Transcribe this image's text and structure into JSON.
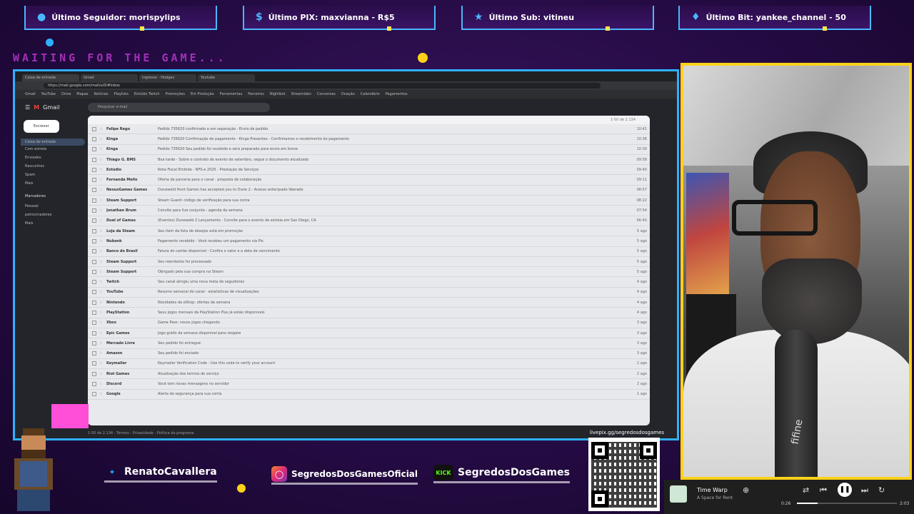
{
  "alerts": {
    "follower": "Último Seguidor: morispylips",
    "pix": "Último PIX: maxvianna - R$5",
    "sub": "Último Sub: vitineu",
    "bit": "Último Bit: yankee_channel - 50"
  },
  "overlay": {
    "waiting_text": "WAITING FOR THE GAME..."
  },
  "browser": {
    "tabs": [
      "Caixa de entrada",
      "Gmail",
      "Ingresso - Hodges",
      "Youtube"
    ],
    "url": "https://mail.google.com/mail/u/0/#inbox",
    "bookmarks": [
      "Gmail",
      "YouTube",
      "Drive",
      "Mapas",
      "Notícias",
      "Playlists",
      "Estúdio Twitch",
      "Promoções",
      "Em Produção",
      "Ferramentas",
      "Parceiros",
      "Nightbot",
      "Streamlabs",
      "Conversas",
      "Doação",
      "Calendário",
      "Pagamentos"
    ]
  },
  "gmail": {
    "app_name": "Gmail",
    "search_placeholder": "Pesquisar e-mail",
    "compose_label": "Escrever",
    "nav": [
      "Caixa de entrada",
      "Com estrela",
      "Enviados",
      "Rascunhos",
      "Spam",
      "Mais"
    ],
    "markers_label": "Marcadores",
    "markers": [
      "Pessoal",
      "patrocinadores",
      "Mais"
    ],
    "toolbar_range": "1-50 de 2.134",
    "rows": [
      {
        "sender": "Felipe Rego",
        "subject": "Pedido 735620 confirmado e em separação - Envio de pedido",
        "time": "10:41"
      },
      {
        "sender": "Kinga",
        "subject": "Pedido 735620 Confirmação de pagamento - Kinga Presentes - Confirmamos o recebimento do pagamento",
        "time": "10:36"
      },
      {
        "sender": "Kinga",
        "subject": "Pedido 735620 Seu pedido foi recebido e será preparado para envio em breve",
        "time": "10:30"
      },
      {
        "sender": "Thiago G. BMS",
        "subject": "Boa tarde - Sobre o contrato do evento de setembro, segue o documento atualizado",
        "time": "09:58"
      },
      {
        "sender": "Estúdio",
        "subject": "Nota Fiscal Emitida - NFS-e 2025 - Prestação de Serviços",
        "time": "09:40"
      },
      {
        "sender": "Fernanda Mello",
        "subject": "Oferta de parceria para o canal - proposta de colaboração",
        "time": "09:11"
      },
      {
        "sender": "NexusGames Games",
        "subject": "Duneweld Hunt Games has accepted you to Dune 2 - Acesso antecipado liberado",
        "time": "08:57"
      },
      {
        "sender": "Steam Support",
        "subject": "Steam Guard: código de verificação para sua conta",
        "time": "08:22"
      },
      {
        "sender": "Jonathan Brum",
        "subject": "Convite para live conjunta - agenda da semana",
        "time": "07:54"
      },
      {
        "sender": "Duel of Games",
        "subject": "(Eventos) Duneweld 2 Lançamento - Convite para o evento de estreia em San Diego, CA",
        "time": "06:40"
      },
      {
        "sender": "Loja da Steam",
        "subject": "Seu item da lista de desejos está em promoção",
        "time": "5 ago"
      },
      {
        "sender": "Nubank",
        "subject": "Pagamento recebido - Você recebeu um pagamento via Pix",
        "time": "5 ago"
      },
      {
        "sender": "Banco do Brasil",
        "subject": "Fatura do cartão disponível - Confira o valor e a data de vencimento",
        "time": "5 ago"
      },
      {
        "sender": "Steam Support",
        "subject": "Seu reembolso foi processado",
        "time": "5 ago"
      },
      {
        "sender": "Steam Support",
        "subject": "Obrigado pela sua compra na Steam",
        "time": "5 ago"
      },
      {
        "sender": "Twitch",
        "subject": "Seu canal atingiu uma nova meta de seguidores",
        "time": "4 ago"
      },
      {
        "sender": "YouTube",
        "subject": "Resumo semanal do canal - estatísticas de visualizações",
        "time": "4 ago"
      },
      {
        "sender": "Nintendo",
        "subject": "Novidades da eShop: ofertas da semana",
        "time": "4 ago"
      },
      {
        "sender": "PlayStation",
        "subject": "Seus jogos mensais da PlayStation Plus já estão disponíveis",
        "time": "4 ago"
      },
      {
        "sender": "Xbox",
        "subject": "Game Pass: novos jogos chegando",
        "time": "3 ago"
      },
      {
        "sender": "Epic Games",
        "subject": "Jogo grátis da semana disponível para resgate",
        "time": "3 ago"
      },
      {
        "sender": "Mercado Livre",
        "subject": "Seu pedido foi entregue",
        "time": "3 ago"
      },
      {
        "sender": "Amazon",
        "subject": "Seu pedido foi enviado",
        "time": "3 ago"
      },
      {
        "sender": "Keymailer",
        "subject": "Keymailer Verification Code - Use this code to verify your account",
        "time": "2 ago"
      },
      {
        "sender": "Riot Games",
        "subject": "Atualização dos termos de serviço",
        "time": "2 ago"
      },
      {
        "sender": "Discord",
        "subject": "Você tem novas mensagens no servidor",
        "time": "2 ago"
      },
      {
        "sender": "Google",
        "subject": "Alerta de segurança para sua conta",
        "time": "1 ago"
      }
    ],
    "footer": "1-50 de 2.134 - Termos - Privacidade - Política do programa"
  },
  "socials": {
    "twitter": "RenatoCavallera",
    "instagram": "SegredosDosGamesOficial",
    "kick": "SegredosDosGames"
  },
  "qr": {
    "label": "livepix.gg/segredosdosgames"
  },
  "cam": {
    "mic_brand": "fifine"
  },
  "player": {
    "track": "Time Warp",
    "artist": "A Space for Rent",
    "elapsed": "0:26",
    "duration": "2:03",
    "progress": 0.21
  },
  "colors": {
    "accent": "#2fb0ff",
    "yellow": "#ffd21a",
    "purple": "#250b44"
  }
}
